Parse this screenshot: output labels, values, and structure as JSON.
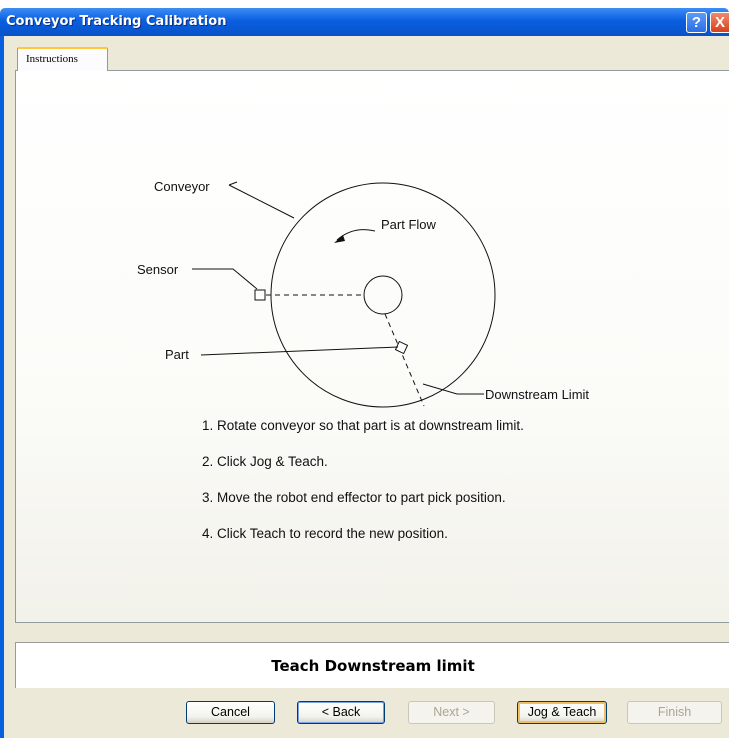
{
  "window": {
    "title": "Conveyor Tracking Calibration",
    "help_glyph": "?",
    "close_glyph": "X"
  },
  "tabs": [
    {
      "label": "Instructions",
      "active": true
    }
  ],
  "diagram": {
    "labels": {
      "conveyor": "Conveyor",
      "part_flow": "Part Flow",
      "sensor": "Sensor",
      "part": "Part",
      "downstream_limit": "Downstream Limit"
    }
  },
  "steps": [
    "1. Rotate conveyor so that part is at downstream limit.",
    "2. Click Jog & Teach.",
    "3. Move the robot end effector to part pick position.",
    "4. Click Teach to record the new position."
  ],
  "status": {
    "text": "Teach Downstream limit"
  },
  "buttons": {
    "cancel": {
      "label": "Cancel",
      "enabled": true
    },
    "back": {
      "label": "< Back",
      "enabled": true
    },
    "next": {
      "label": "Next >",
      "enabled": false
    },
    "jog_teach": {
      "label": "Jog & Teach",
      "enabled": true
    },
    "finish": {
      "label": "Finish",
      "enabled": false
    }
  },
  "colors": {
    "titlebar": "#0a5fe0",
    "dialog_face": "#ece9d8",
    "tab_highlight": "#ffc83c",
    "close_button": "#d8401c"
  }
}
